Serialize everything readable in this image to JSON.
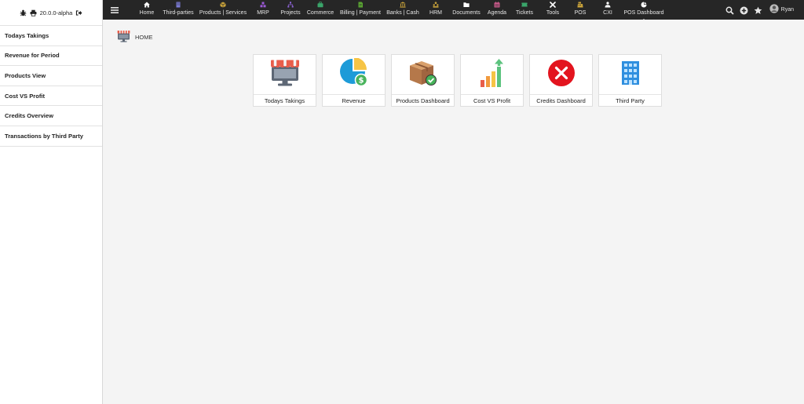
{
  "sidebar": {
    "version": "20.0.0-alpha",
    "items": [
      {
        "label": "Todays Takings"
      },
      {
        "label": "Revenue for Period"
      },
      {
        "label": "Products View"
      },
      {
        "label": "Cost VS Profit"
      },
      {
        "label": "Credits Overview"
      },
      {
        "label": "Transactions by Third Party"
      }
    ]
  },
  "topbar": {
    "nav": [
      {
        "label": "Home",
        "icon": "home-icon",
        "color": "#ffffff"
      },
      {
        "label": "Third-parties",
        "icon": "building-icon",
        "color": "#7b7bd6"
      },
      {
        "label": "Products | Services",
        "icon": "cube-icon",
        "color": "#c8a23a"
      },
      {
        "label": "MRP",
        "icon": "cubes-icon",
        "color": "#9b59d6"
      },
      {
        "label": "Projects",
        "icon": "sitemap-icon",
        "color": "#8e64d8"
      },
      {
        "label": "Commerce",
        "icon": "suitcase-icon",
        "color": "#3aa56a"
      },
      {
        "label": "Billing | Payment",
        "icon": "invoice-icon",
        "color": "#5aa532"
      },
      {
        "label": "Banks | Cash",
        "icon": "bank-icon",
        "color": "#c8a23a"
      },
      {
        "label": "HRM",
        "icon": "people-icon",
        "color": "#c8a23a"
      },
      {
        "label": "Documents",
        "icon": "folder-icon",
        "color": "#ffffff"
      },
      {
        "label": "Agenda",
        "icon": "calendar-icon",
        "color": "#c85a8a"
      },
      {
        "label": "Tickets",
        "icon": "ticket-icon",
        "color": "#3aa56a"
      },
      {
        "label": "Tools",
        "icon": "tools-icon",
        "color": "#ffffff"
      },
      {
        "label": "POS",
        "icon": "cash-register-icon",
        "color": "#c8a23a"
      },
      {
        "label": "CXI",
        "icon": "user-upload-icon",
        "color": "#ffffff"
      },
      {
        "label": "POS Dashboard",
        "icon": "pie-chart-icon",
        "color": "#ffffff",
        "active": true
      }
    ],
    "user": {
      "name": "Ryan"
    }
  },
  "breadcrumb": {
    "label": "HOME"
  },
  "cards": [
    {
      "label": "Todays Takings",
      "icon": "shop-icon"
    },
    {
      "label": "Revenue",
      "icon": "pie-revenue-icon"
    },
    {
      "label": "Products Dashboard",
      "icon": "box-check-icon"
    },
    {
      "label": "Cost VS Profit",
      "icon": "growth-chart-icon"
    },
    {
      "label": "Credits Dashboard",
      "icon": "red-x-icon"
    },
    {
      "label": "Third Party",
      "icon": "office-building-icon"
    }
  ]
}
